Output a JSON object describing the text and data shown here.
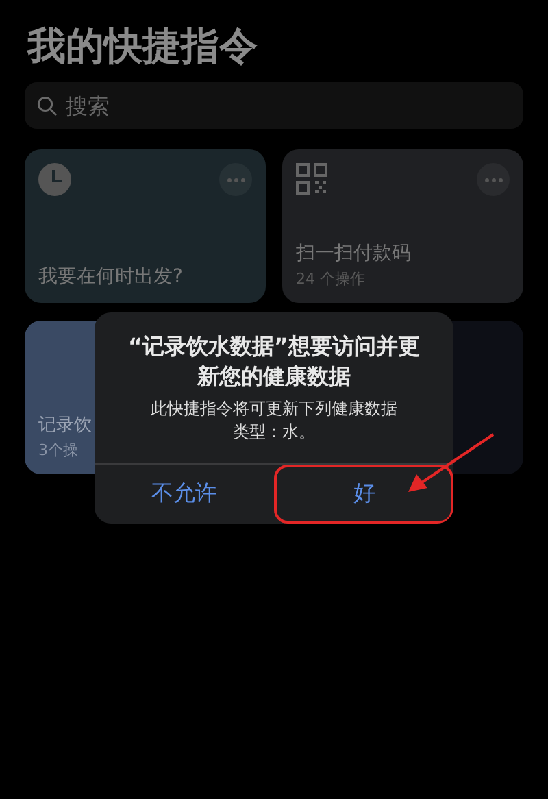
{
  "title": "我的快捷指令",
  "search": {
    "placeholder": "搜索"
  },
  "shortcuts": [
    {
      "kind": "clock",
      "name": "我要在何时出发?",
      "color": "#1b262b",
      "more": true
    },
    {
      "kind": "qr",
      "name": "扫一扫付款码",
      "subtitle": "24 个操作",
      "color": "#1f2023",
      "more": true
    },
    {
      "kind": "plain",
      "name": "记录饮",
      "subtitle": "3个操",
      "color": "#3a4a64",
      "more": false
    },
    {
      "kind": "plain",
      "color": "#0d0f16",
      "more": false
    }
  ],
  "dialog": {
    "title": "“记录饮水数据”想要访问并更新您的健康数据",
    "message": "此快捷指令将可更新下列健康数据类型：水。",
    "buttons": [
      {
        "label": "不允许",
        "highlighted": false
      },
      {
        "label": "好",
        "highlighted": true
      }
    ]
  }
}
